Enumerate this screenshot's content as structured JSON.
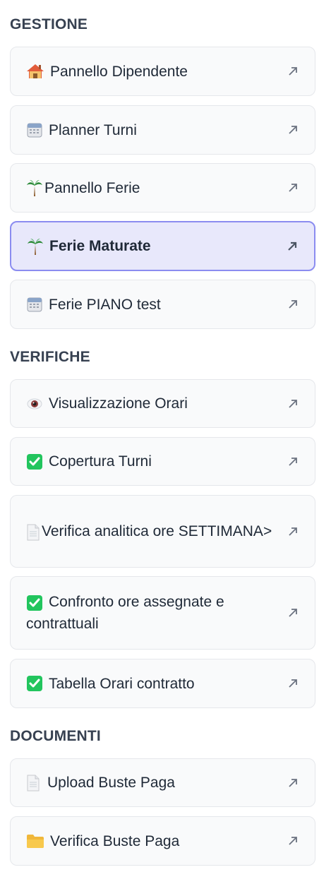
{
  "sections": [
    {
      "title": "GESTIONE",
      "items": [
        {
          "icon": "house-icon",
          "label": "Pannello Dipendente",
          "active": false
        },
        {
          "icon": "calendar-icon",
          "label": "Planner Turni",
          "active": false
        },
        {
          "icon": "palm-tree-icon",
          "label": "Pannello Ferie",
          "active": false
        },
        {
          "icon": "palm-tree-icon",
          "label": "Ferie Maturate",
          "active": true
        },
        {
          "icon": "calendar-icon",
          "label": "Ferie PIANO test",
          "active": false
        }
      ]
    },
    {
      "title": "VERIFICHE",
      "items": [
        {
          "icon": "eye-icon",
          "label": "Visualizzazione Orari",
          "active": false
        },
        {
          "icon": "check-mark-icon",
          "label": "Copertura Turni",
          "active": false
        },
        {
          "icon": "document-icon",
          "label": "Verifica analitica ore SETTIMANA>",
          "active": false
        },
        {
          "icon": "check-mark-icon",
          "label": "Confronto ore assegnate e contrattuali",
          "active": false
        },
        {
          "icon": "check-mark-icon",
          "label": "Tabella Orari contratto",
          "active": false
        }
      ]
    },
    {
      "title": "DOCUMENTI",
      "items": [
        {
          "icon": "document-icon",
          "label": "Upload Buste Paga",
          "active": false
        },
        {
          "icon": "folder-icon",
          "label": "Verifica Buste Paga",
          "active": false
        }
      ]
    }
  ],
  "colors": {
    "button_bg": "#f9fafb",
    "button_border": "#e5e7eb",
    "active_bg": "#e8e8fb",
    "active_border": "#8b8cf0",
    "heading": "#374151",
    "text": "#1f2937",
    "check_green": "#22c55e"
  }
}
